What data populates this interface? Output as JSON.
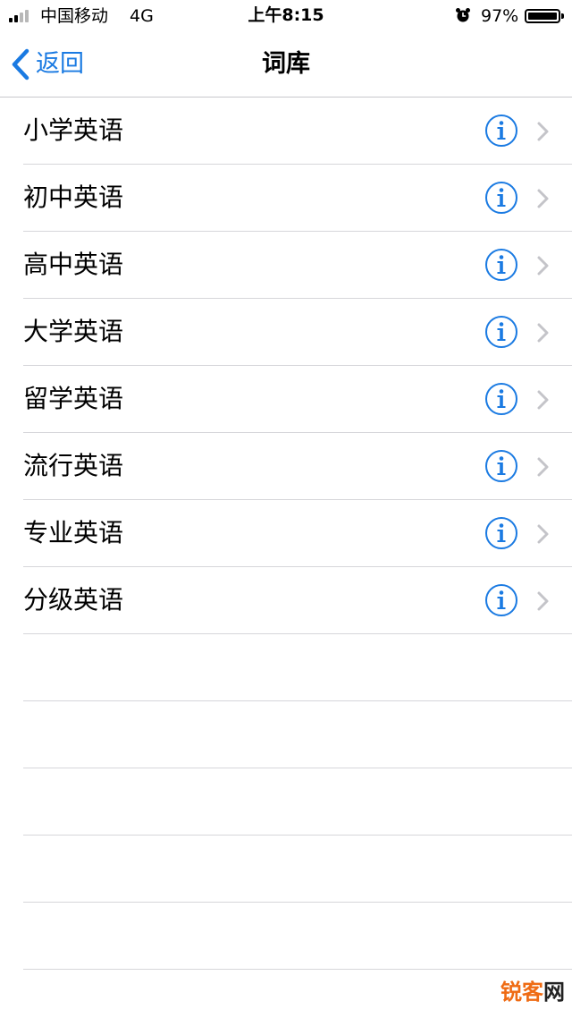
{
  "status_bar": {
    "carrier": "中国移动",
    "network": "4G",
    "time": "上午8:15",
    "battery_percent": "97%",
    "battery_level": 0.97,
    "alarm_icon": "alarm-clock-icon"
  },
  "nav": {
    "back_label": "返回",
    "title": "词库",
    "accent_color": "#1a7ae2"
  },
  "list": {
    "items": [
      {
        "label": "小学英语"
      },
      {
        "label": "初中英语"
      },
      {
        "label": "高中英语"
      },
      {
        "label": "大学英语"
      },
      {
        "label": "留学英语"
      },
      {
        "label": "流行英语"
      },
      {
        "label": "专业英语"
      },
      {
        "label": "分级英语"
      }
    ],
    "info_icon": "info-circle-icon",
    "chevron_icon": "chevron-right-icon"
  },
  "watermark": {
    "part_a": "锐",
    "part_b": "客",
    "part_c": "网"
  }
}
